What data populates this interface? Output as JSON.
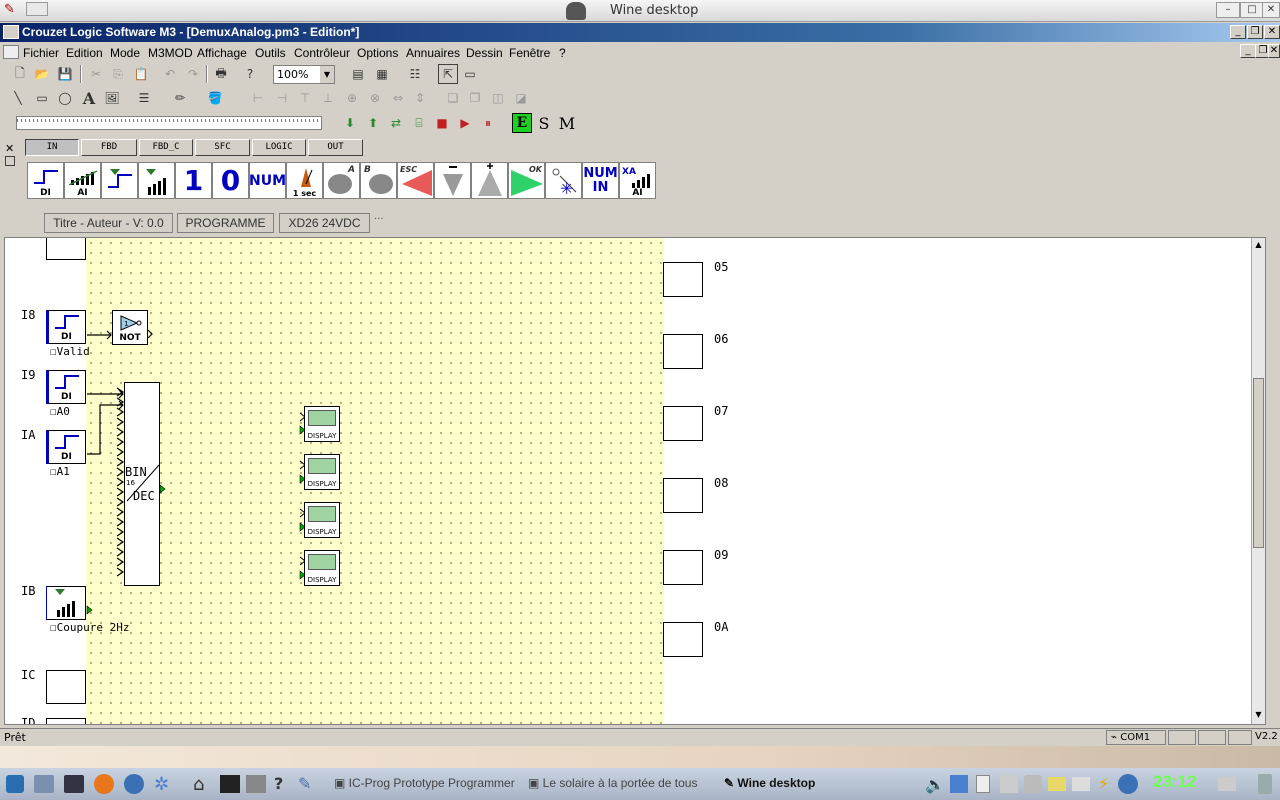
{
  "wine": {
    "title": "Wine desktop"
  },
  "app": {
    "title": "Crouzet Logic Software M3 - [DemuxAnalog.pm3 - Edition*]"
  },
  "menu": [
    "Fichier",
    "Edition",
    "Mode",
    "M3MOD",
    "Affichage",
    "Outils",
    "Contrôleur",
    "Options",
    "Annuaires",
    "Dessin",
    "Fenêtre",
    "?"
  ],
  "toolbar": {
    "zoom": "100%",
    "e": "E",
    "s": "S",
    "m": "M"
  },
  "tabs": [
    "IN",
    "FBD",
    "FBD_C",
    "SFC",
    "LOGIC",
    "OUT"
  ],
  "palette": {
    "di": "DI",
    "ai": "AI",
    "one": "1",
    "zero": "0",
    "num": "NUM",
    "sec": "1 sec",
    "a": "A",
    "b": "B",
    "esc": "ESC",
    "ok": "OK",
    "numin_1": "NUM",
    "numin_2": "IN",
    "xa": "XA",
    "xa_ai": "AI"
  },
  "header": {
    "title": "Titre - Auteur - V: 0.0",
    "program": "PROGRAMME",
    "controller": "XD26 24VDC"
  },
  "inputs": {
    "i8": "I8",
    "i9": "I9",
    "ia": "IA",
    "ib": "IB",
    "ic": "IC",
    "id": "ID",
    "valid": "Valid",
    "a0": "A0",
    "a1": "A1",
    "coupure": "Coupure 2Hz",
    "di": "DI"
  },
  "blocks": {
    "not": "NOT",
    "bin": "BIN",
    "dec": "DEC",
    "sixteen": "16",
    "display": "DISPLAY"
  },
  "outputs": [
    "05",
    "06",
    "07",
    "08",
    "09",
    "0A"
  ],
  "status": {
    "ready": "Prêt",
    "port": "COM1",
    "version": "V2.2"
  },
  "taskbar": {
    "task1": "IC-Prog Prototype Programmer",
    "task2": "Le solaire à la portée de tous",
    "task3": "Wine desktop",
    "clock": "23:12"
  }
}
